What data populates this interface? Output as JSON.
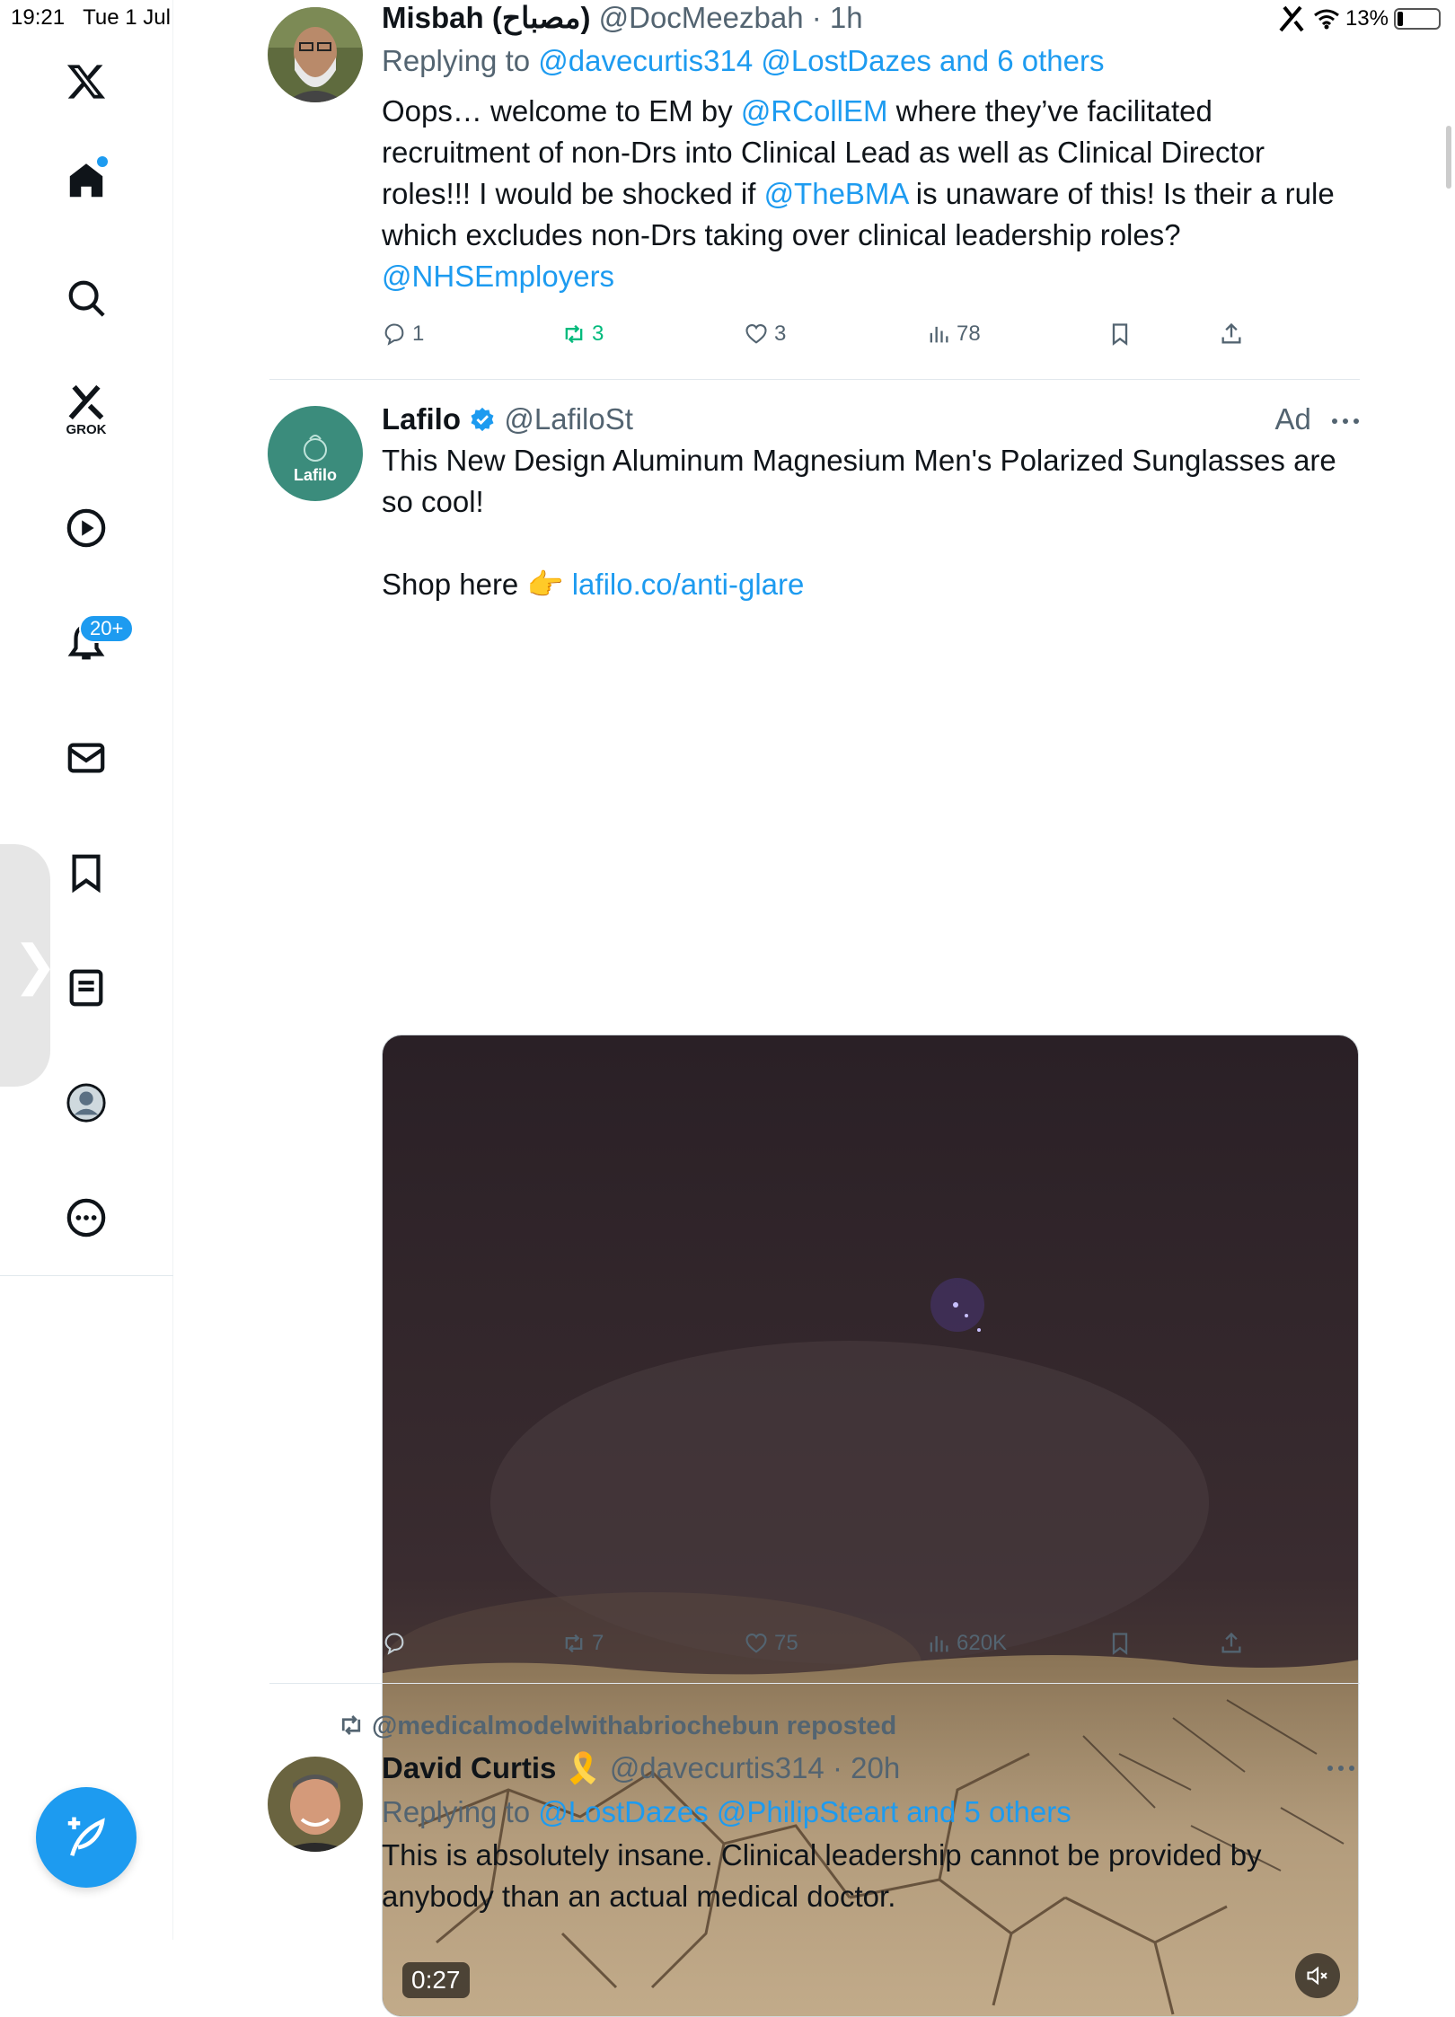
{
  "status_bar": {
    "time": "19:21",
    "date": "Tue 1 Jul",
    "battery": "13%"
  },
  "sidebar": {
    "grok_label": "GROK",
    "notifications_badge": "20+",
    "drawer_glyph": "❯"
  },
  "tweet1": {
    "name": "Misbah (مصباح)",
    "handle": "@DocMeezbah",
    "time": "· 1h",
    "reply_prefix": "Replying to",
    "reply_targets": "@davecurtis314 @LostDazes and 6 others",
    "text_part1": "Oops… welcome to EM by ",
    "mention1": "@RCollEM",
    "text_part2": " where they’ve facilitated recruitment of non-Drs into Clinical Lead as well as Clinical Director roles!!! I would be shocked if ",
    "mention2": "@TheBMA",
    "text_part3": " is unaware of this! Is their a rule which excludes non-Drs taking over clinical leadership roles?",
    "mention3": "@NHSEmployers",
    "replies": "1",
    "reposts": "3",
    "likes": "3",
    "views": "78"
  },
  "tweet2": {
    "name": "Lafilo",
    "handle": "@LafiloSt",
    "ad_label": "Ad",
    "avatar_text": "Lafilo",
    "text_line1": "This New Design Aluminum Magnesium Men's Polarized Sunglasses are so cool!",
    "shop_text": "Shop here 👉 ",
    "shop_link": "lafilo.co/anti-glare",
    "video_duration": "0:27",
    "reposts": "7",
    "likes": "75",
    "views": "620K"
  },
  "tweet3": {
    "repost_by": "@medicalmodelwithabriochebun reposted",
    "name": "David Curtis",
    "ribbon": "🎗️",
    "handle": "@davecurtis314",
    "time": "· 20h",
    "reply_prefix": "Replying to",
    "reply_targets": "@LostDazes @PhilipSteart and 5 others",
    "text": "This is absolutely insane. Clinical leadership cannot be provided by anybody than an actual medical doctor."
  },
  "colors": {
    "accent": "#1d9bf0",
    "repost_green": "#00ba7c",
    "muted": "#536471"
  }
}
